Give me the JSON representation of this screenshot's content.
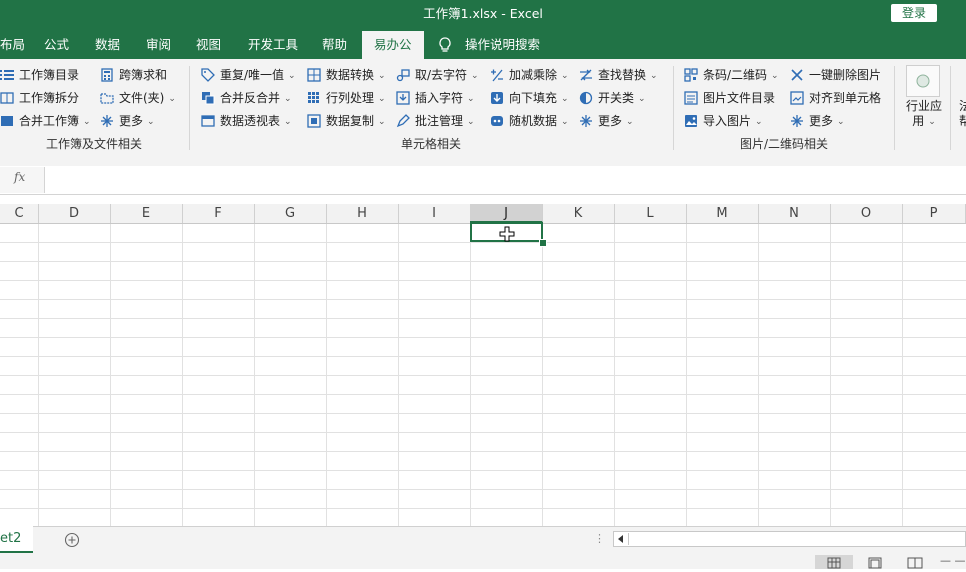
{
  "window": {
    "title": "工作簿1.xlsx  -  Excel",
    "login_label": "登录"
  },
  "tabs": [
    {
      "label": "布局"
    },
    {
      "label": "公式"
    },
    {
      "label": "数据"
    },
    {
      "label": "审阅"
    },
    {
      "label": "视图"
    },
    {
      "label": "开发工具"
    },
    {
      "label": "帮助"
    },
    {
      "label": "易办公",
      "active": true
    },
    {
      "label": "操作说明搜索"
    }
  ],
  "ribbon": {
    "groups": [
      {
        "label": "工作簿及文件相关",
        "items": [
          "工作簿目录",
          "工作簿拆分",
          "合并工作簿",
          "跨簿求和",
          "文件(夹)",
          "更多"
        ]
      },
      {
        "label": "单元格相关",
        "items": [
          "重复/唯一值",
          "合并反合并",
          "数据透视表",
          "数据转换",
          "行列处理",
          "数据复制",
          "取/去字符",
          "插入字符",
          "批注管理",
          "加减乘除",
          "向下填充",
          "随机数据",
          "查找替换",
          "开关类",
          "更多"
        ]
      },
      {
        "label": "图片/二维码相关",
        "items": [
          "条码/二维码",
          "图片文件目录",
          "导入图片",
          "一键删除图片",
          "对齐到单元格",
          "更多"
        ]
      }
    ],
    "industry": {
      "line1": "行业应",
      "line2": "用"
    },
    "cut_line1": "法",
    "cut_line2": "帮"
  },
  "formula_bar": {
    "fx_label": "fx",
    "value": ""
  },
  "grid": {
    "columns": [
      "C",
      "D",
      "E",
      "F",
      "G",
      "H",
      "I",
      "J",
      "K",
      "L",
      "M",
      "N",
      "O",
      "P"
    ],
    "selected_column": "J"
  },
  "sheet_tabs": [
    {
      "label": "et2",
      "active": true
    }
  ],
  "status_bar": {
    "zoom_prefix": "— —"
  }
}
